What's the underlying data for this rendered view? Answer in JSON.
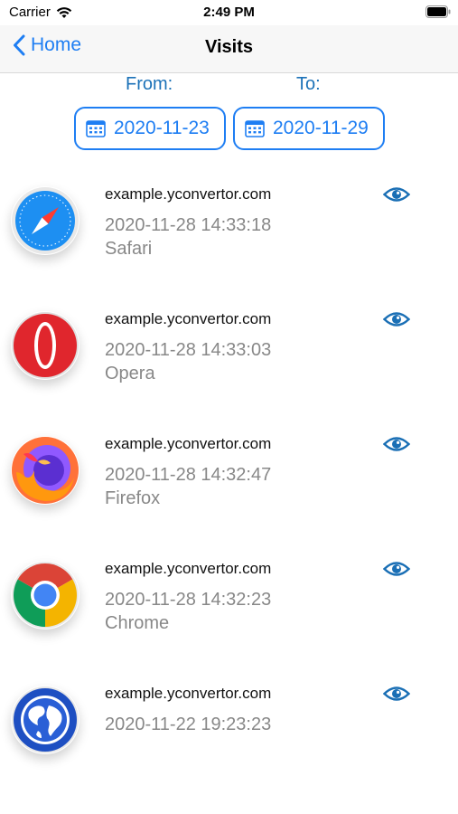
{
  "status_bar": {
    "carrier": "Carrier",
    "time": "2:49 PM",
    "icons": [
      "wifi-icon",
      "battery-icon"
    ]
  },
  "nav": {
    "back_label": "Home",
    "title": "Visits"
  },
  "filter": {
    "from_label": "From:",
    "to_label": "To:",
    "from_date": "2020-11-23",
    "to_date": "2020-11-29"
  },
  "visits": [
    {
      "host": "example.yconvertor.com",
      "time": "2020-11-28 14:33:18",
      "browser": "Safari",
      "icon": "safari-icon"
    },
    {
      "host": "example.yconvertor.com",
      "time": "2020-11-28 14:33:03",
      "browser": "Opera",
      "icon": "opera-icon"
    },
    {
      "host": "example.yconvertor.com",
      "time": "2020-11-28 14:32:47",
      "browser": "Firefox",
      "icon": "firefox-icon"
    },
    {
      "host": "example.yconvertor.com",
      "time": "2020-11-28 14:32:23",
      "browser": "Chrome",
      "icon": "chrome-icon"
    },
    {
      "host": "example.yconvertor.com",
      "time": "2020-11-22 19:23:23",
      "browser": "",
      "icon": "globe-icon"
    }
  ],
  "colors": {
    "accent": "#1e7ef3",
    "label_blue": "#1c72b8",
    "secondary_text": "#888888",
    "eye": "#1a6fb5"
  }
}
